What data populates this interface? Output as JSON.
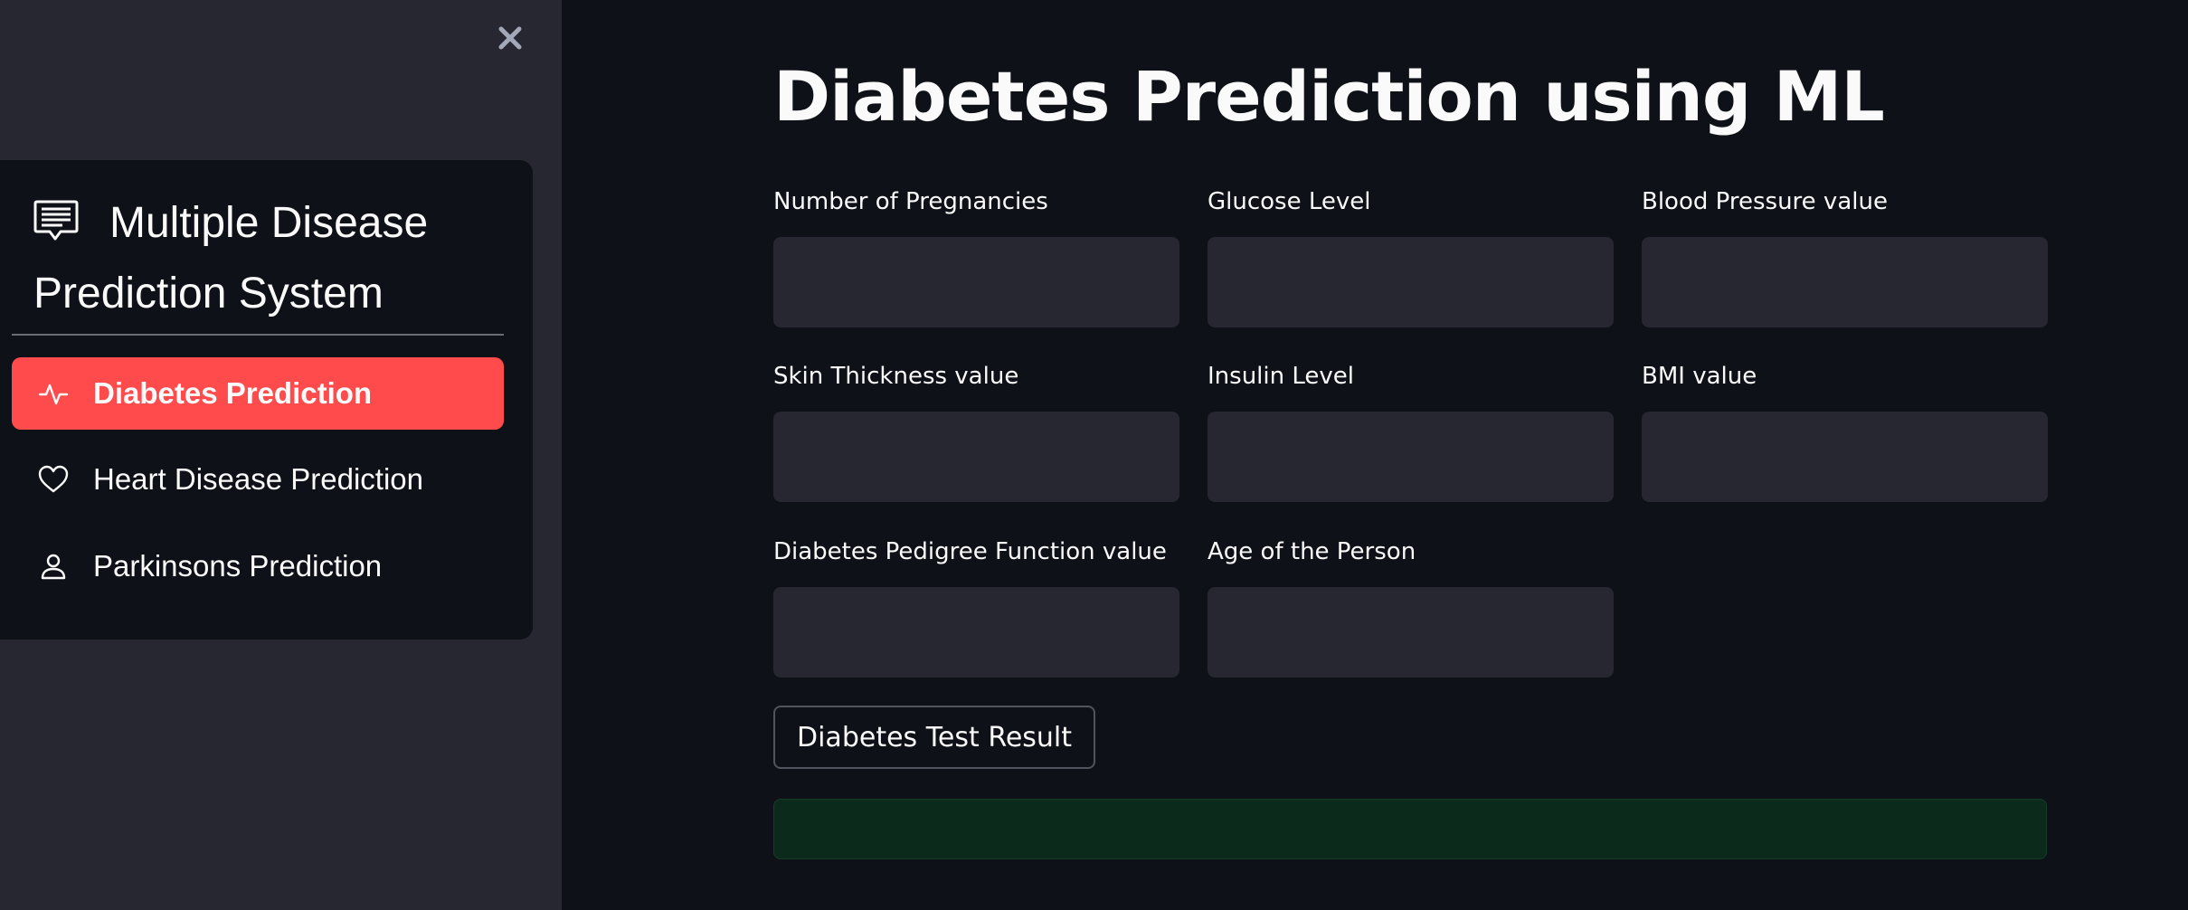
{
  "sidebar": {
    "close_icon": "close-icon",
    "menu": {
      "header_icon": "message-square-text-icon",
      "title": "Multiple Disease Prediction System",
      "items": [
        {
          "label": "Diabetes Prediction",
          "icon": "activity-icon",
          "active": true
        },
        {
          "label": "Heart Disease Prediction",
          "icon": "heart-icon",
          "active": false
        },
        {
          "label": "Parkinsons Prediction",
          "icon": "person-icon",
          "active": false
        }
      ],
      "active_color": "#ff4b4b"
    }
  },
  "main": {
    "title": "Diabetes Prediction using ML",
    "fields": [
      {
        "label": "Number of Pregnancies",
        "value": ""
      },
      {
        "label": "Glucose Level",
        "value": ""
      },
      {
        "label": "Blood Pressure value",
        "value": ""
      },
      {
        "label": "Skin Thickness value",
        "value": ""
      },
      {
        "label": "Insulin Level",
        "value": ""
      },
      {
        "label": "BMI value",
        "value": ""
      },
      {
        "label": "Diabetes Pedigree Function value",
        "value": ""
      },
      {
        "label": "Age of the Person",
        "value": ""
      }
    ],
    "submit_label": "Diabetes Test Result",
    "result_text": ""
  },
  "colors": {
    "background": "#0e1117",
    "sidebar": "#262730",
    "input": "#262730",
    "success": "#0b2a1c",
    "text": "#fafafa"
  }
}
